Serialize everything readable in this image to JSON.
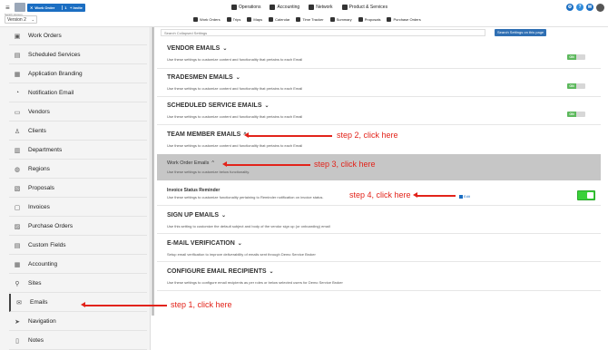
{
  "header": {
    "work_order_label": "Work Order",
    "work_order_count": "1",
    "invite_label": "Invite",
    "switch_version_label": "Switch Version",
    "version_value": "Version 2",
    "nav": [
      {
        "label": "Operations",
        "icon": "operations-icon"
      },
      {
        "label": "Accounting",
        "icon": "accounting-icon"
      },
      {
        "label": "Network",
        "icon": "network-icon"
      },
      {
        "label": "Product & Services",
        "icon": "product-icon"
      }
    ],
    "subnav": [
      {
        "label": "Work Orders",
        "icon": "work-orders-icon"
      },
      {
        "label": "Trips",
        "icon": "trips-icon"
      },
      {
        "label": "Maps",
        "icon": "maps-icon"
      },
      {
        "label": "Calendar",
        "icon": "calendar-icon"
      },
      {
        "label": "Time Tracker",
        "icon": "time-tracker-icon"
      },
      {
        "label": "Summary",
        "icon": "summary-icon"
      },
      {
        "label": "Proposals",
        "icon": "proposals-icon"
      },
      {
        "label": "Purchase Orders",
        "icon": "purchase-orders-icon"
      }
    ]
  },
  "sidebar": {
    "items": [
      {
        "label": "Work Orders",
        "icon": "clipboard-icon"
      },
      {
        "label": "Scheduled Services",
        "icon": "calendar-repeat-icon"
      },
      {
        "label": "Application Branding",
        "icon": "branding-icon"
      },
      {
        "label": "Notification Email",
        "icon": "bell-icon"
      },
      {
        "label": "Vendors",
        "icon": "truck-icon"
      },
      {
        "label": "Clients",
        "icon": "user-icon"
      },
      {
        "label": "Departments",
        "icon": "building-icon"
      },
      {
        "label": "Regions",
        "icon": "globe-icon"
      },
      {
        "label": "Proposals",
        "icon": "document-icon"
      },
      {
        "label": "Invoices",
        "icon": "invoice-icon"
      },
      {
        "label": "Purchase Orders",
        "icon": "cart-icon"
      },
      {
        "label": "Custom Fields",
        "icon": "list-icon"
      },
      {
        "label": "Accounting",
        "icon": "calculator-icon"
      },
      {
        "label": "Sites",
        "icon": "map-pin-icon"
      },
      {
        "label": "Emails",
        "icon": "email-icon"
      },
      {
        "label": "Navigation",
        "icon": "navigation-icon"
      },
      {
        "label": "Notes",
        "icon": "note-icon"
      }
    ]
  },
  "main": {
    "search_placeholder": "Search Collapsed Settings",
    "search_button": "Search Settings on this page",
    "sections": [
      {
        "title": "VENDOR EMAILS",
        "chevron": "⌄",
        "desc": "Use these settings to customize content and functionality that pertains to each Email",
        "toggle": "ON"
      },
      {
        "title": "TRADESMEN EMAILS",
        "chevron": "⌄",
        "desc": "Use these settings to customize content and functionality that pertains to each Email",
        "toggle": "ON"
      },
      {
        "title": "SCHEDULED SERVICE EMAILS",
        "chevron": "⌄",
        "desc": "Use these settings to customize content and functionality that pertains to each Email",
        "toggle": "ON"
      },
      {
        "title": "TEAM MEMBER EMAILS",
        "chevron": "^",
        "desc": "Use these settings to customize content and functionality that pertains to each Email"
      }
    ],
    "work_order_emails": {
      "title": "Work Order Emails",
      "chevron": "^",
      "desc": "Use these settings to customize below functionality."
    },
    "invoice_status": {
      "title": "Invoice Status Reminder",
      "desc": "Use these settings to customize functionality pertaining to Reminder notification on invoice status.",
      "edit_label": "Edit"
    },
    "lower_sections": [
      {
        "title": "SIGN UP EMAILS",
        "chevron": "⌄",
        "desc": "Use this setting to customize the default subject and body of the vendor sign up (or onboarding) email"
      },
      {
        "title": "E-MAIL VERIFICATION",
        "chevron": "⌄",
        "desc": "Setup email verification to improve deliverability of emails sent through Demo Service Broker"
      },
      {
        "title": "CONFIGURE EMAIL RECIPIENTS",
        "chevron": "⌄",
        "desc": "Use these settings to configure email recipients as per roles or below selected users for Demo Service Broker"
      }
    ]
  },
  "annotations": {
    "step1": "step 1, click here",
    "step2": "step 2, click here",
    "step3": "step 3, click here",
    "step4": "step 4, click here"
  },
  "colors": {
    "accent": "#1b6ec2",
    "annotation": "#e2231a",
    "toggle_on": "#5cb85c"
  }
}
